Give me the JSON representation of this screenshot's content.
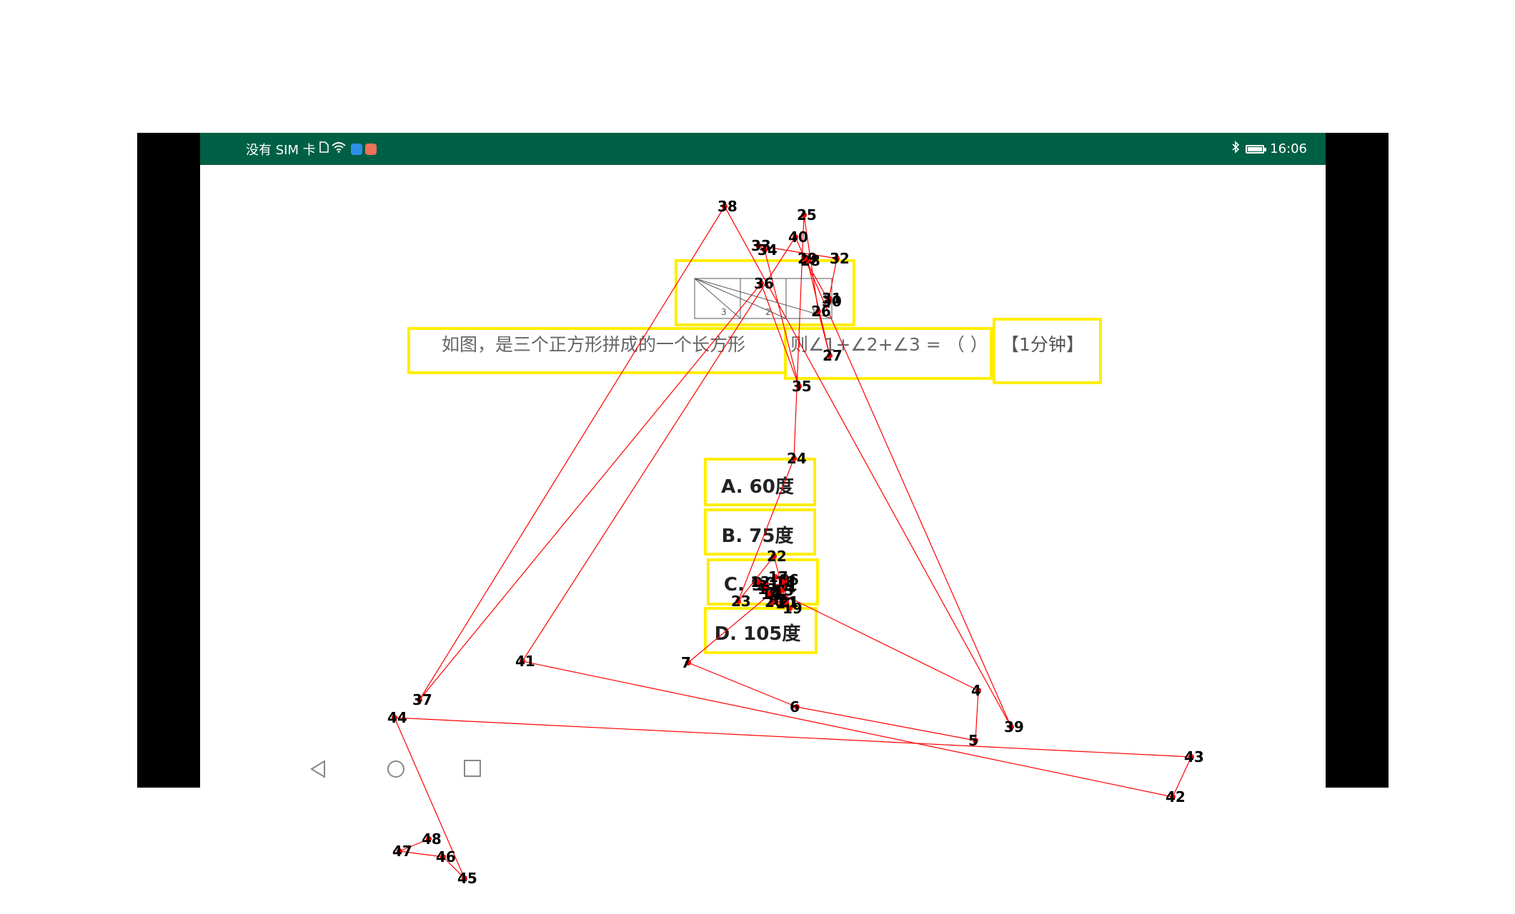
{
  "status_bar": {
    "carrier": "没有 SIM 卡",
    "time": "16:06",
    "background_color": "#006045",
    "icons": [
      "sim-icon",
      "wifi-icon",
      "app-icon-blue",
      "app-icon-photo",
      "bluetooth-icon",
      "battery-icon"
    ]
  },
  "question": {
    "text_part1": "如图，是三个正方形拼成的一个长方形",
    "text_part2": "则∠1+∠2+∠3 = （ ）",
    "time_tag": "【1分钟】",
    "figure_labels": [
      "3",
      "2",
      "1"
    ]
  },
  "options": [
    {
      "label": "A. 60度"
    },
    {
      "label": "B. 75度"
    },
    {
      "label": "C. 90度"
    },
    {
      "label": "D. 105度"
    }
  ],
  "nav_bar": {
    "buttons": [
      "back-icon",
      "home-icon",
      "recents-icon"
    ]
  },
  "gaze_overlay": {
    "line_color": "#ff0000",
    "box_color": "#ffee00",
    "fixation_labels": [
      "1",
      "2",
      "3",
      "4",
      "5",
      "6",
      "7",
      "8",
      "9",
      "10",
      "11",
      "12",
      "13",
      "14",
      "15",
      "16",
      "17",
      "18",
      "19",
      "20",
      "21",
      "22",
      "23",
      "24",
      "25",
      "26",
      "27",
      "28",
      "29",
      "30",
      "31",
      "32",
      "33",
      "34",
      "35",
      "36",
      "37",
      "38",
      "39",
      "40",
      "41",
      "42",
      "43",
      "44",
      "45",
      "46",
      "47",
      "48"
    ]
  }
}
